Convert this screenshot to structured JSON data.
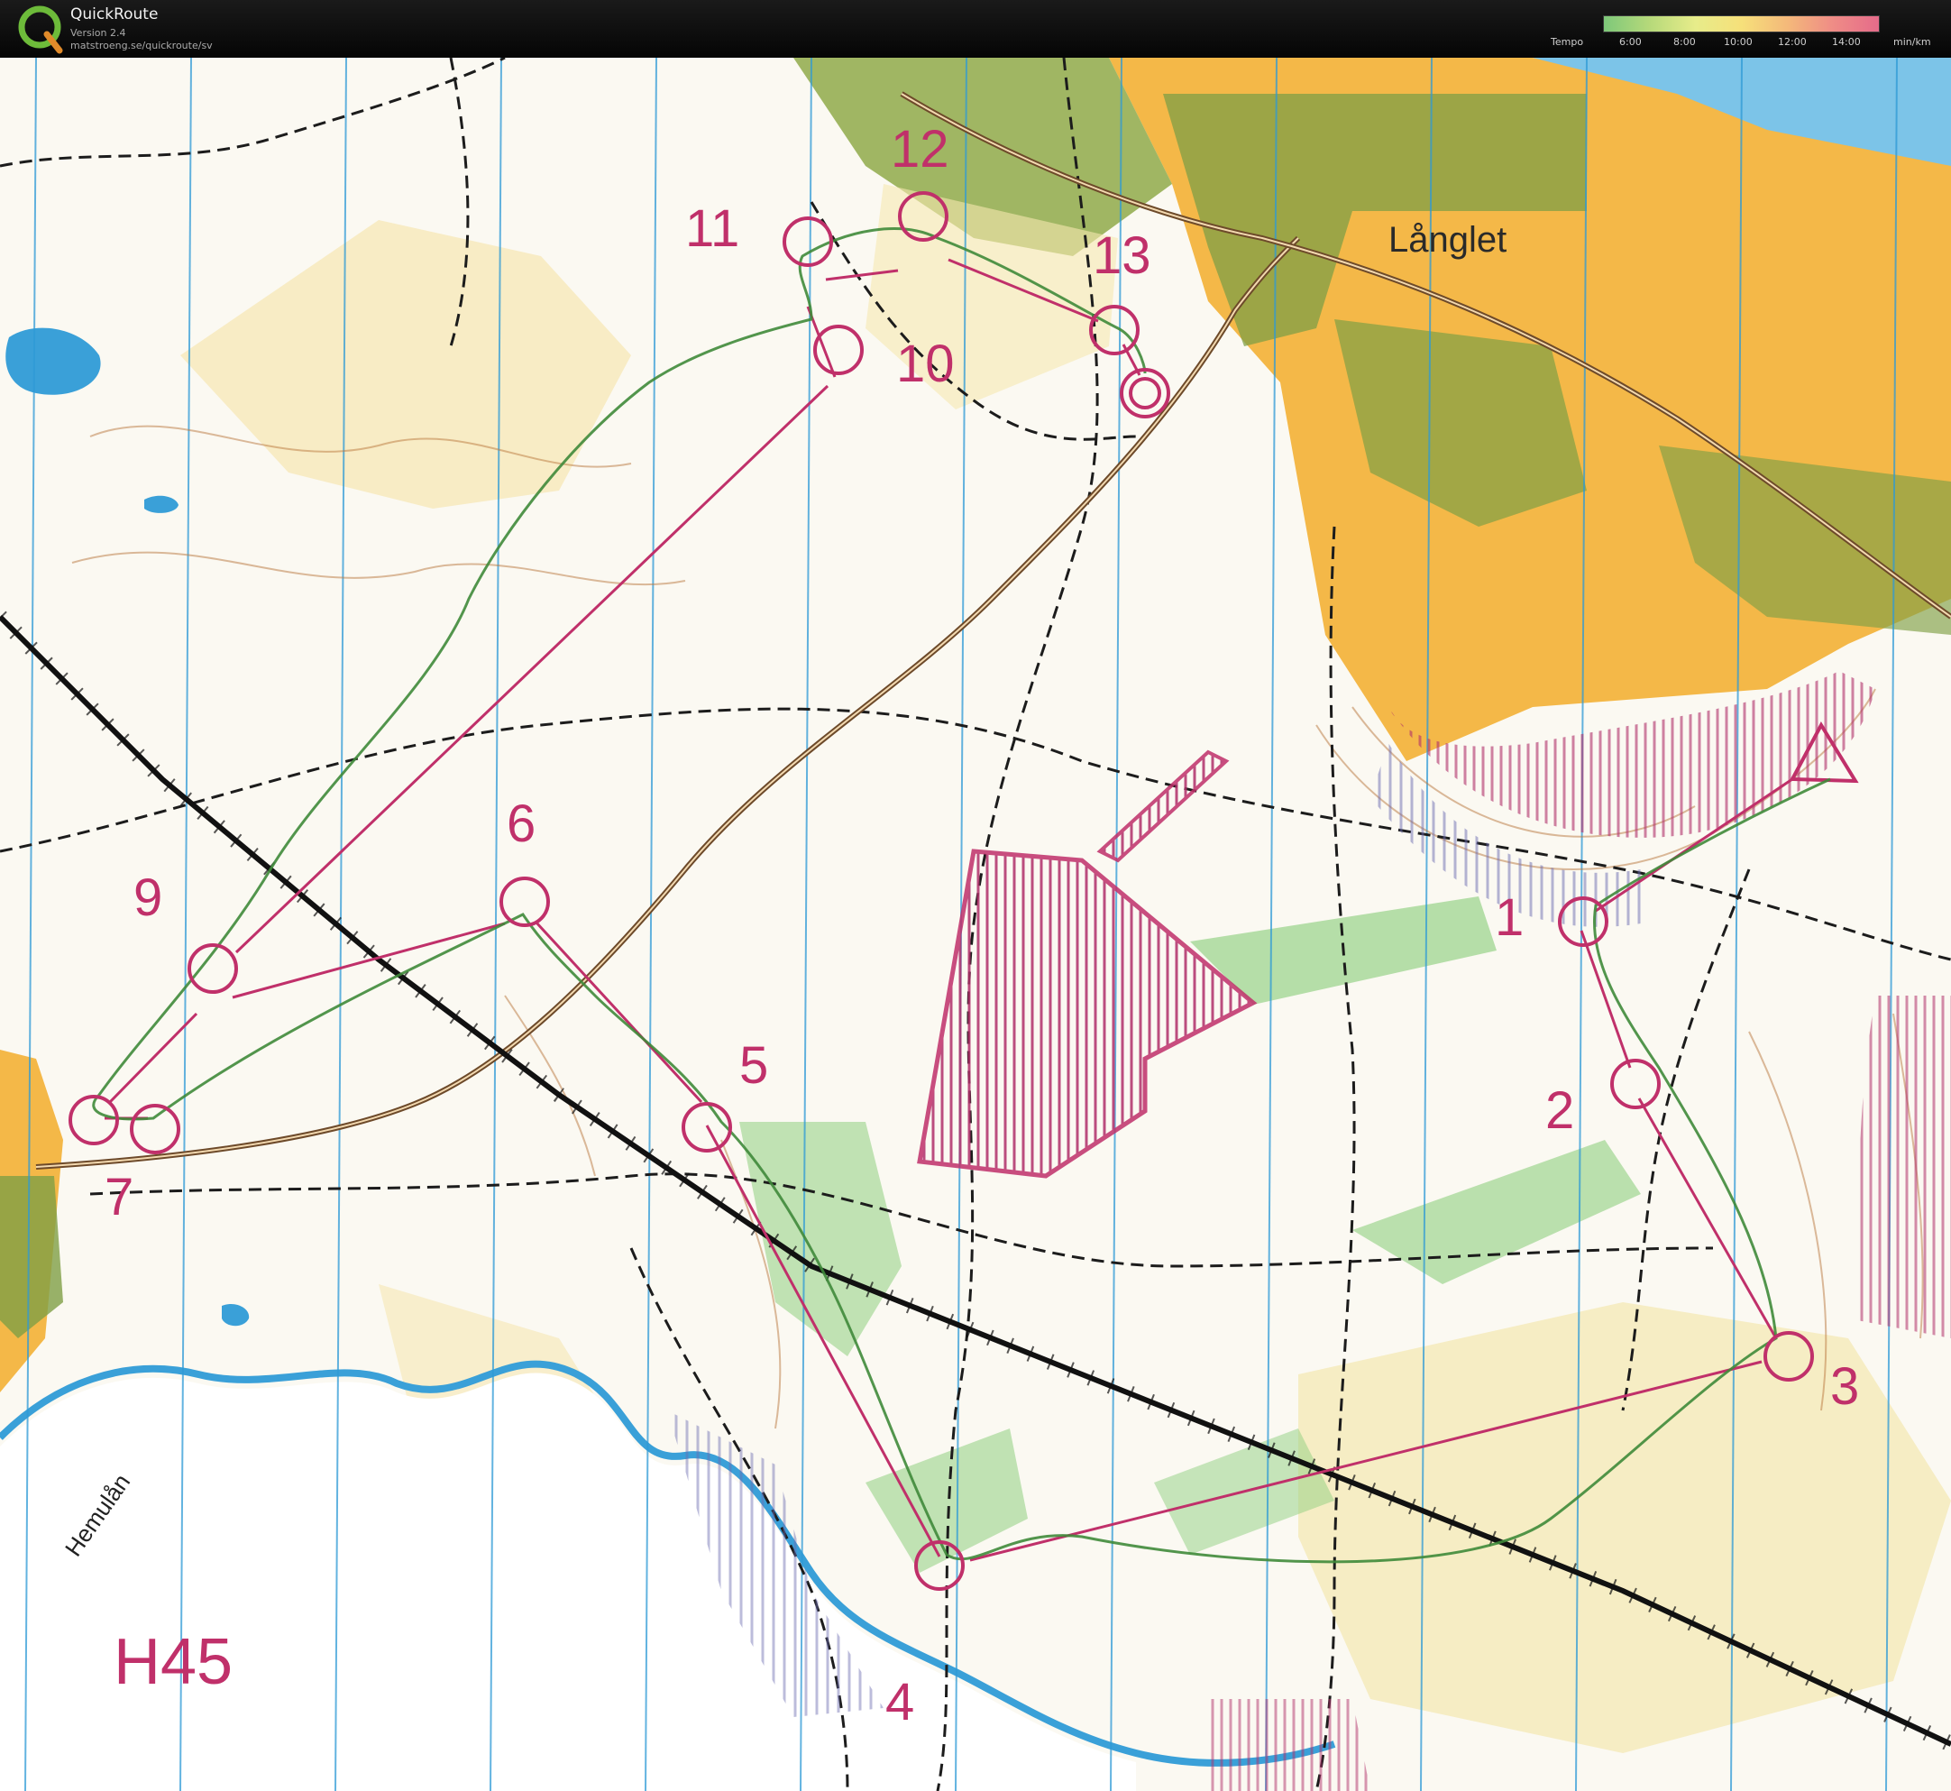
{
  "app": {
    "title": "QuickRoute",
    "version": "Version 2.4",
    "url": "matstroeng.se/quickroute/sv"
  },
  "legend": {
    "label": "Tempo",
    "ticks": [
      "6:00",
      "8:00",
      "10:00",
      "12:00",
      "14:00"
    ],
    "unit": "min/km"
  },
  "map": {
    "class_label": "H45",
    "place_names": [
      "Långlet"
    ],
    "river_name": "Hemulån",
    "controls": [
      "1",
      "2",
      "3",
      "4",
      "5",
      "6",
      "7",
      "9",
      "10",
      "11",
      "12",
      "13"
    ],
    "colors": {
      "course": "#c0306a",
      "route": "#3f8a3a",
      "urban": "#f0b43a",
      "water": "#3aa0d8",
      "grid": "#2e9ad6"
    }
  }
}
